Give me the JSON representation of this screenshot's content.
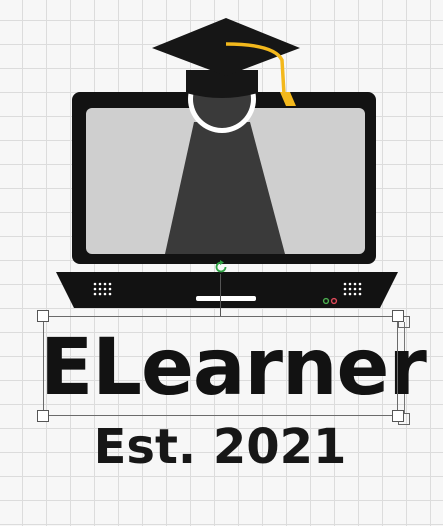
{
  "canvas": {
    "title_text": "ELearner",
    "subtitle_text": "Est. 2021"
  },
  "colors": {
    "laptop_body": "#121212",
    "screen": "#cfcfcf",
    "figure": "#3a3a3a",
    "tassel": "#f3b81c",
    "rotate_handle": "#2ea043",
    "grid": "#dcdcdc"
  },
  "icons": [
    "graduation-cap-icon",
    "laptop-icon",
    "rotate-icon",
    "speaker-grill-icon"
  ]
}
